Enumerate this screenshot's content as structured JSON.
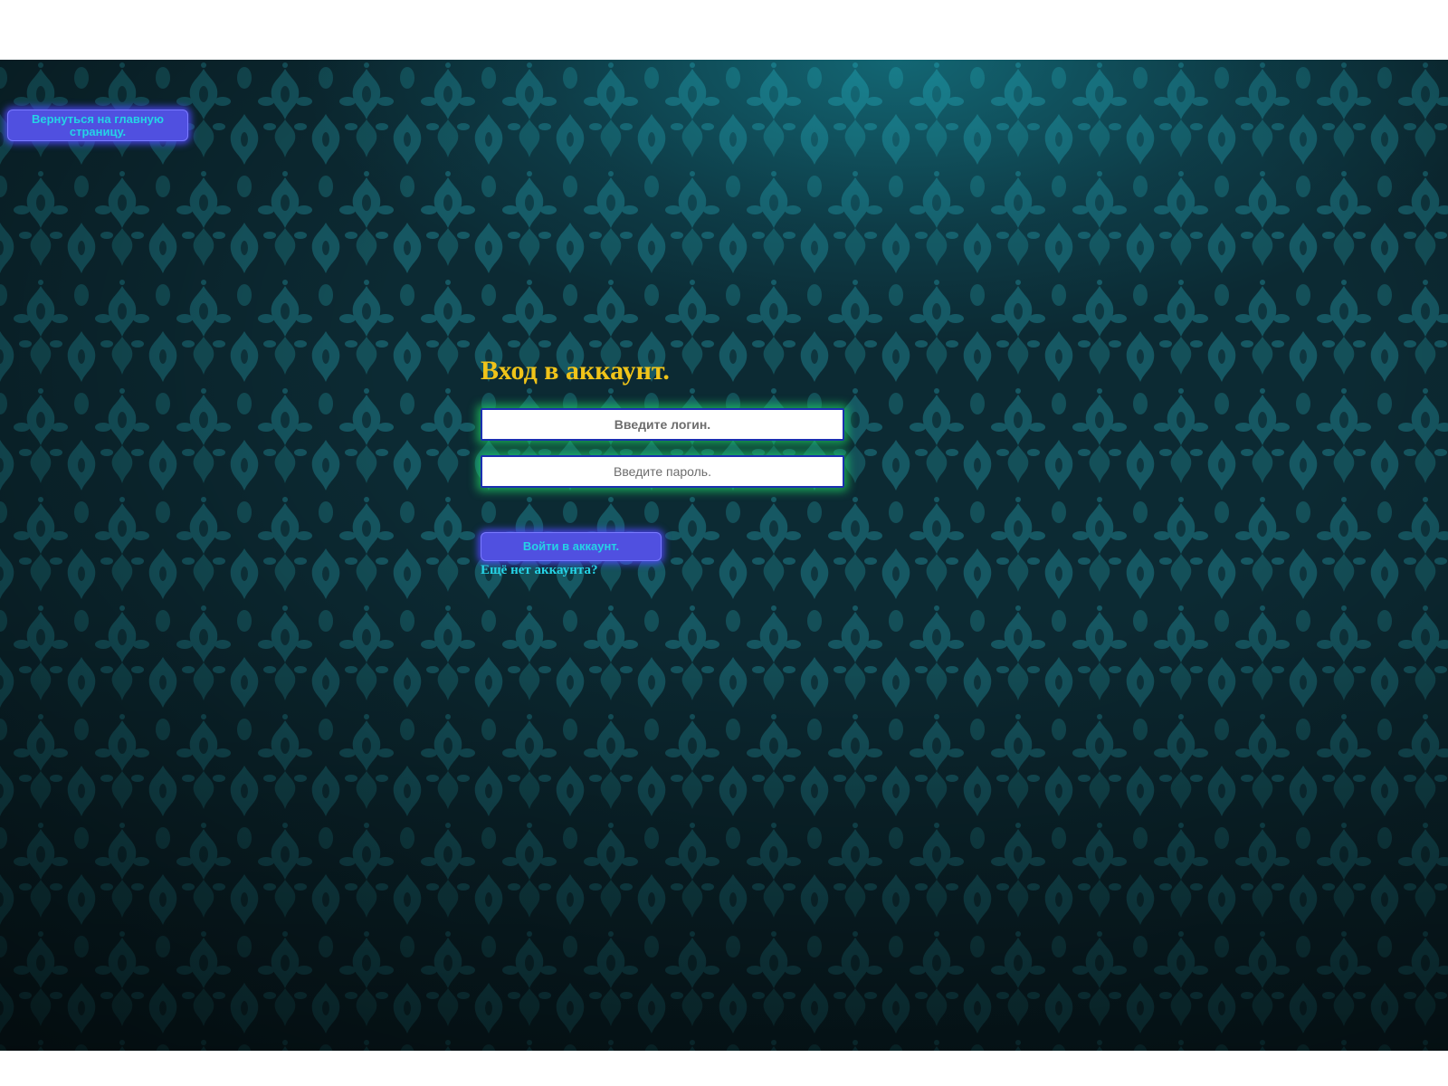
{
  "back_button": {
    "label": "Вернуться на главную страницу."
  },
  "login_form": {
    "title": "Вход в аккаунт.",
    "login_placeholder": "Введите логин.",
    "password_placeholder": "Введите пароль.",
    "submit_label": "Войти в аккаунт.",
    "register_link": "Ещё нет аккаунта?"
  },
  "colors": {
    "background": "#0c2a33",
    "pattern": "#17606b",
    "title": "#f0c419",
    "button": "#5050e0",
    "button_text": "#25d3e6",
    "input_border": "#1b2fb0",
    "input_glow": "#1ed264",
    "link": "#25d3e6"
  }
}
